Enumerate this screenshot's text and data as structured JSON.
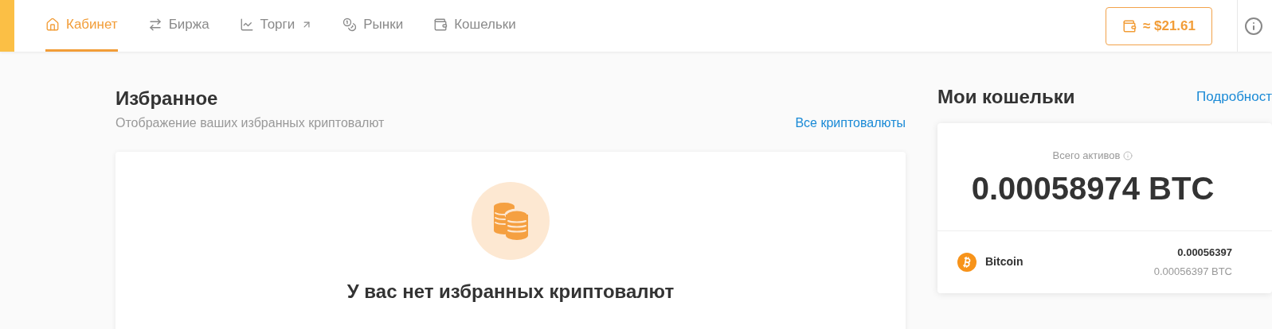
{
  "nav": [
    {
      "label": "Кабинет",
      "selected": true
    },
    {
      "label": "Биржа",
      "selected": false
    },
    {
      "label": "Торги",
      "selected": false,
      "external": true
    },
    {
      "label": "Рынки",
      "selected": false
    },
    {
      "label": "Кошельки",
      "selected": false
    }
  ],
  "balance_button": "≈ $21.61",
  "favorites": {
    "title": "Избранное",
    "subtitle": "Отображение ваших избранных криптовалют",
    "link": "Все криптовалюты",
    "empty_title": "У вас нет избранных криптовалют"
  },
  "wallets": {
    "title": "Мои кошельки",
    "link": "Подробност",
    "total_label": "Всего активов",
    "total": "0.00058974 BTC",
    "rows": [
      {
        "name": "Bitcoin",
        "amount": "0.00056397",
        "amount_btc": "0.00056397 BTC"
      }
    ]
  }
}
